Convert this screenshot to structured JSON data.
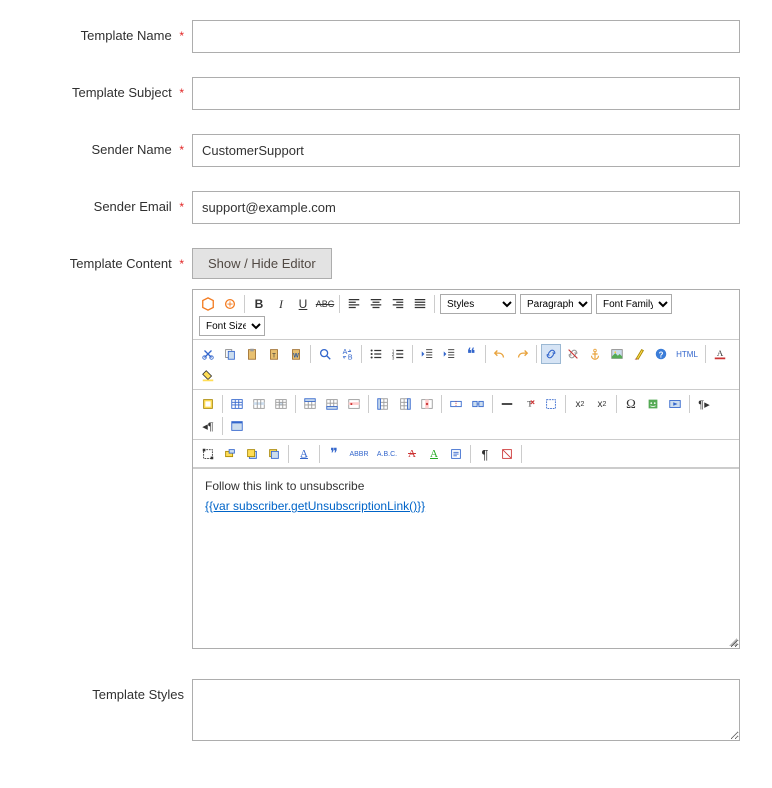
{
  "fields": {
    "template_name": {
      "label": "Template Name",
      "value": "",
      "required": true
    },
    "template_subject": {
      "label": "Template Subject",
      "value": "",
      "required": true
    },
    "sender_name": {
      "label": "Sender Name",
      "value": "CustomerSupport",
      "required": true
    },
    "sender_email": {
      "label": "Sender Email",
      "value": "support@example.com",
      "required": true
    },
    "template_content": {
      "label": "Template Content",
      "required": true
    },
    "template_styles": {
      "label": "Template Styles",
      "value": "",
      "required": false
    }
  },
  "required_mark": "*",
  "buttons": {
    "toggle_editor": "Show / Hide Editor"
  },
  "editor": {
    "selects": {
      "styles": "Styles",
      "format": "Paragraph",
      "fontfamily": "Font Family",
      "fontsize": "Font Size"
    },
    "content_line1": "Follow this link to unsubscribe",
    "content_line2": "{{var subscriber.getUnsubscriptionLink()}}"
  },
  "toolbar_icons": {
    "row1": [
      "magento-widget-icon",
      "magento-variable-icon",
      "bold-icon",
      "italic-icon",
      "underline-icon",
      "strikethrough-icon",
      "align-left-icon",
      "align-center-icon",
      "align-right-icon",
      "align-justify-icon"
    ],
    "row2": [
      "cut-icon",
      "copy-icon",
      "paste-icon",
      "paste-text-icon",
      "paste-word-icon",
      "find-icon",
      "replace-icon",
      "bullet-list-icon",
      "number-list-icon",
      "outdent-icon",
      "indent-icon",
      "blockquote-icon",
      "undo-icon",
      "redo-icon",
      "link-icon",
      "unlink-icon",
      "anchor-icon",
      "image-icon",
      "cleanup-icon",
      "help-icon",
      "html-icon",
      "text-color-icon",
      "bg-color-icon"
    ],
    "row3": [
      "nbsp-row-icon",
      "table-icon",
      "row-props-icon",
      "cell-props-icon",
      "insert-row-before-icon",
      "insert-row-after-icon",
      "delete-row-icon",
      "insert-col-before-icon",
      "insert-col-after-icon",
      "delete-col-icon",
      "split-cells-icon",
      "merge-cells-icon",
      "hr-icon",
      "remove-format-icon",
      "sub-icon",
      "sup-icon",
      "omega-icon",
      "emoticon-icon",
      "media-icon",
      "ltr-icon",
      "rtl-icon",
      "fullscreen-icon"
    ],
    "row4": [
      "crop-icon",
      "layer-absolute-icon",
      "layer-forward-icon",
      "layer-backward-icon",
      "styleprops-icon",
      "cite-icon",
      "abbr-icon",
      "acronym-icon",
      "del-icon",
      "ins-icon",
      "attribs-icon",
      "visualchars-icon",
      "nbsp-icon"
    ]
  }
}
